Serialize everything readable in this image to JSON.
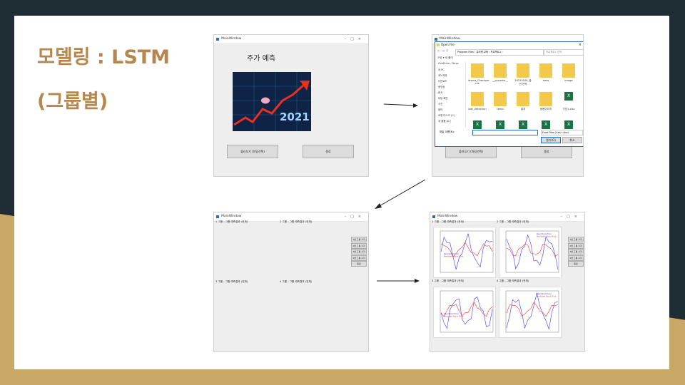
{
  "slide": {
    "title_line1": "모델링 : LSTM",
    "title_line2": "(그룹별)"
  },
  "window1": {
    "title": "MainWindow",
    "heading": "주가 예측",
    "banner_text": "2021",
    "btn_load": "불러오기 (파일선택)",
    "btn_exit": "종료"
  },
  "window2": {
    "title": "MainWindow",
    "dialog_title": "Open File",
    "breadcrumb": "Program Files › 유비쿼 교육 › 프로젝트1 ›",
    "search_placeholder": "프로젝트1 검색",
    "toolbar": "구성 ▾   새 폴더",
    "nav": [
      "OneDrive - Perso",
      "내 PC",
      "3D 개체",
      "다운로드",
      "동영상",
      "문서",
      "바탕 화면",
      "사진",
      "음악",
      "로컬 디스크 (C:)",
      "새 볼륨 (D:)"
    ],
    "files": [
      "layout_Checkpoi nts",
      "__pycache__",
      "20210106_증권 전략",
      "data",
      "image",
      "last_detection",
      "temp",
      "결과",
      "동봉이미지",
      "기업1.xlsx"
    ],
    "filename_label": "파일 이름(N):",
    "filetype": "Excel Files (*.xls *.xlsx)",
    "open_btn": "열기(O)",
    "cancel_btn": "취소",
    "btn_load": "불러오기 (파일선택)",
    "btn_exit": "종료"
  },
  "window3": {
    "title": "MainWindow",
    "sections": [
      "1 그룹 - 그룹 예측결과 (전체)",
      "2 그룹 - 그룹 예측결과 (전체)",
      "3 그룹 - 그룹 예측결과 (전체)",
      "4 그룹 - 그룹 예측결과 (전체)"
    ],
    "side_buttons": [
      "1번 그룹 시각",
      "2번 그룹 시각",
      "3번 그룹 시각",
      "4번 그룹 시각",
      "종료"
    ]
  },
  "window4": {
    "title": "MainWindow",
    "sections": [
      "1 그룹 - 그룹 예측결과 (전체)",
      "2 그룹 - 그룹 예측결과 (전체)",
      "3 그룹 - 그룹 예측결과 (전체)",
      "4 그룹 - 그룹 예측결과 (전체)"
    ],
    "side_buttons": [
      "1번 그룹 시각",
      "2번 그룹 시각",
      "3번 그룹 시각",
      "4번 그룹 시각",
      "종료"
    ],
    "legend": [
      "Real Stock Price",
      "Predicted Stock Price"
    ]
  },
  "colors": {
    "title": "#b5874f",
    "background": "#1f2d35",
    "gold": "#c9a765",
    "real": "#3b3bf0",
    "pred": "#ff3030"
  }
}
